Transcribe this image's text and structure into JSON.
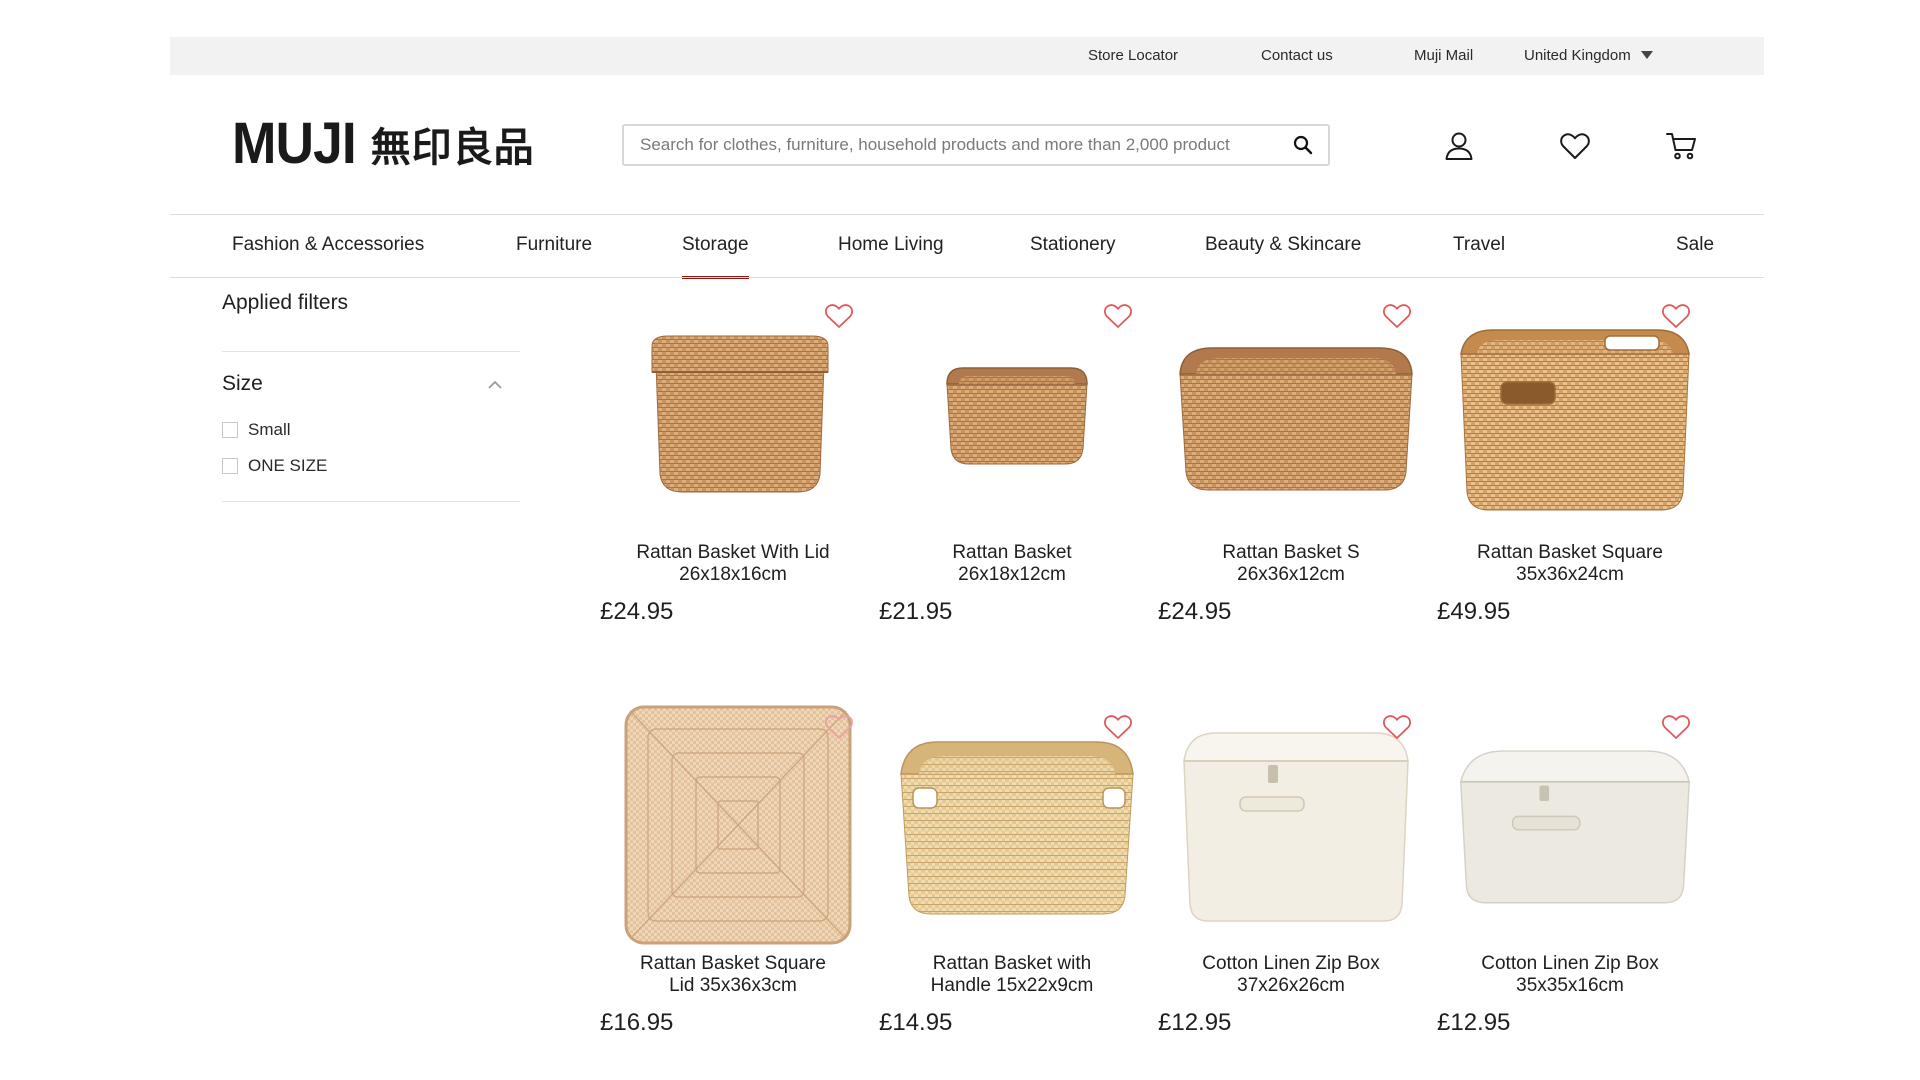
{
  "topbar": {
    "store_locator": "Store Locator",
    "contact": "Contact us",
    "mail": "Muji Mail",
    "country": "United Kingdom"
  },
  "header": {
    "logo_latin": "MUJI",
    "logo_kanji": "無印良品",
    "search_placeholder": "Search for clothes, furniture, household products and more than 2,000 product"
  },
  "nav": {
    "items": [
      {
        "label": "Fashion & Accessories"
      },
      {
        "label": "Furniture"
      },
      {
        "label": "Storage"
      },
      {
        "label": "Home Living"
      },
      {
        "label": "Stationery"
      },
      {
        "label": "Beauty & Skincare"
      },
      {
        "label": "Travel"
      },
      {
        "label": "Sale"
      }
    ],
    "active": "Storage"
  },
  "filters": {
    "applied_label": "Applied filters",
    "size_label": "Size",
    "options": [
      {
        "label": "Small",
        "checked": false
      },
      {
        "label": "ONE SIZE",
        "checked": false
      }
    ]
  },
  "products": [
    {
      "name_line1": "Rattan Basket With Lid",
      "name_line2": "26x18x16cm",
      "price": "£24.95"
    },
    {
      "name_line1": "Rattan Basket",
      "name_line2": "26x18x12cm",
      "price": "£21.95"
    },
    {
      "name_line1": "Rattan Basket S",
      "name_line2": "26x36x12cm",
      "price": "£24.95"
    },
    {
      "name_line1": "Rattan Basket Square",
      "name_line2": "35x36x24cm",
      "price": "£49.95"
    },
    {
      "name_line1": "Rattan Basket Square",
      "name_line2": "Lid 35x36x3cm",
      "price": "£16.95"
    },
    {
      "name_line1": "Rattan Basket with",
      "name_line2": "Handle 15x22x9cm",
      "price": "£14.95"
    },
    {
      "name_line1": "Cotton Linen Zip Box",
      "name_line2": "37x26x26cm",
      "price": "£12.95"
    },
    {
      "name_line1": "Cotton Linen Zip Box",
      "name_line2": "35x35x16cm",
      "price": "£12.95"
    }
  ],
  "colors": {
    "accent_red": "#8b1b1b",
    "heart": "#e05a5a",
    "rattan_dark": "#c48a5a",
    "rattan_light": "#d9b57f",
    "linen": "#efe9dc"
  }
}
